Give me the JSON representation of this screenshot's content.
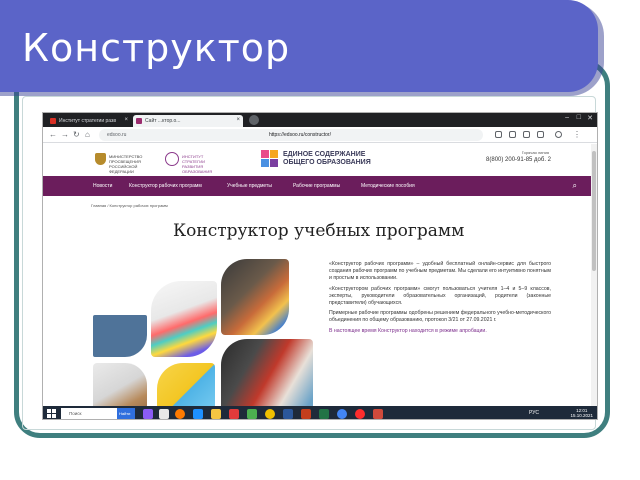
{
  "slide": {
    "title": "Конструктор",
    "colors": {
      "banner": "#5b64c8",
      "frame": "#3f7f7f"
    }
  },
  "browser": {
    "tabs": [
      {
        "label": "Институт стратегии разв",
        "active": false
      },
      {
        "label": "Сайт ...ктор.о...",
        "active": true
      }
    ],
    "url": "https://edsoo.ru/constructor/",
    "address_prefix": "edsoo.ru"
  },
  "site": {
    "ministry": "МИНИСТЕРСТВО ПРОСВЕЩЕНИЯ РОССИЙСКОЙ ФЕДЕРАЦИИ",
    "institute": "ИНСТИТУТ СТРАТЕГИИ РАЗВИТИЯ ОБРАЗОВАНИЯ",
    "brand_line1": "ЕДИНОЕ СОДЕРЖАНИЕ",
    "brand_line2": "ОБЩЕГО ОБРАЗОВАНИЯ",
    "hotline_label": "Горячая линия",
    "hotline": "8(800) 200-91-85 доб. 2",
    "menu": [
      "Новости",
      "Конструктор рабочих программ",
      "Учебные предметы",
      "Рабочие программы",
      "Методические пособия"
    ],
    "breadcrumb": "Главная / Конструктор рабочих программ",
    "heading": "Конструктор учебных программ",
    "paragraphs": [
      "«Конструктор рабочих программ» – удобный бесплатный онлайн-сервис для быстрого создания рабочих программ по учебным предметам. Мы сделали его интуитивно понятным и простым в использовании.",
      "«Конструктором рабочих программ» смогут пользоваться учителя 1–4 и 5–9 классов, эксперты, руководители образовательных организаций, родители (законные представители) обучающихся.",
      "Примерные рабочие программы одобрены решением федерального учебно-методического объединения по общему образованию, протокол 3/21 от 27.09.2021 г."
    ],
    "note": "В настоящее время Конструктор находится в режиме апробации."
  },
  "taskbar": {
    "search_placeholder": "Поиск",
    "search_button": "Найти",
    "tray": "РУС",
    "time": "12:01",
    "date": "15.10.2021"
  }
}
